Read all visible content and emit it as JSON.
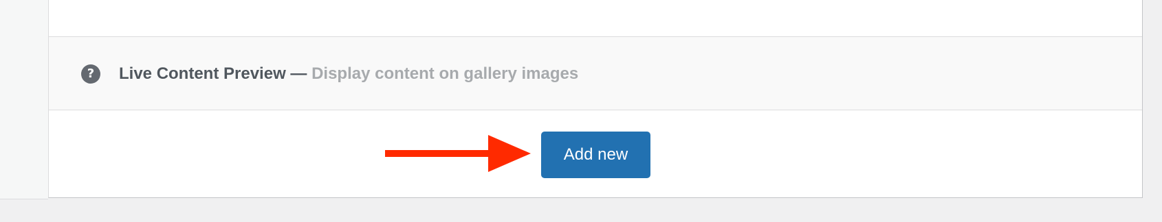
{
  "live_preview": {
    "title": "Live Content Preview",
    "separator": " — ",
    "description": "Display content on gallery images",
    "help_icon_glyph": "?",
    "help_icon_name": "question-circle-icon"
  },
  "actions": {
    "add_new_label": "Add new"
  },
  "annotation": {
    "arrow_color": "#ff2a00"
  },
  "colors": {
    "primary_button": "#2271b1",
    "background": "#f0f0f1"
  }
}
